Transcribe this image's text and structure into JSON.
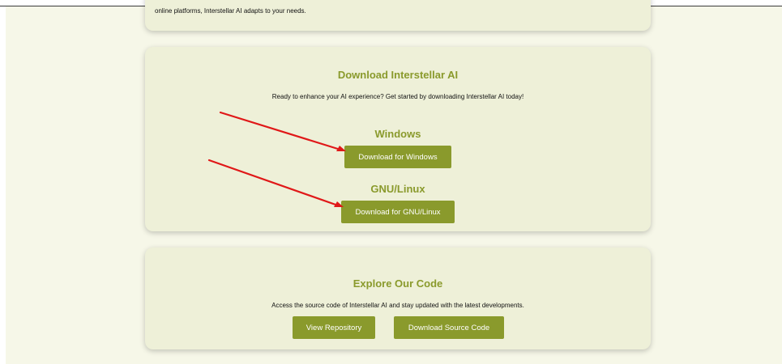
{
  "features_card": {
    "text": "online platforms, Interstellar AI adapts to your needs."
  },
  "download_card": {
    "title": "Download Interstellar AI",
    "description": "Ready to enhance your AI experience? Get started by downloading Interstellar AI today!",
    "windows": {
      "heading": "Windows",
      "button_label": "Download for Windows"
    },
    "linux": {
      "heading": "GNU/Linux",
      "button_label": "Download for GNU/Linux"
    }
  },
  "code_card": {
    "title": "Explore Our Code",
    "description": "Access the source code of Interstellar AI and stay updated with the latest developments.",
    "repo_button_label": "View Repository",
    "source_button_label": "Download Source Code"
  },
  "colors": {
    "accent": "#8a9a2c",
    "card_background": "#eef0d8",
    "page_background": "#f6f7e8",
    "annotation_arrow": "#e01818"
  }
}
